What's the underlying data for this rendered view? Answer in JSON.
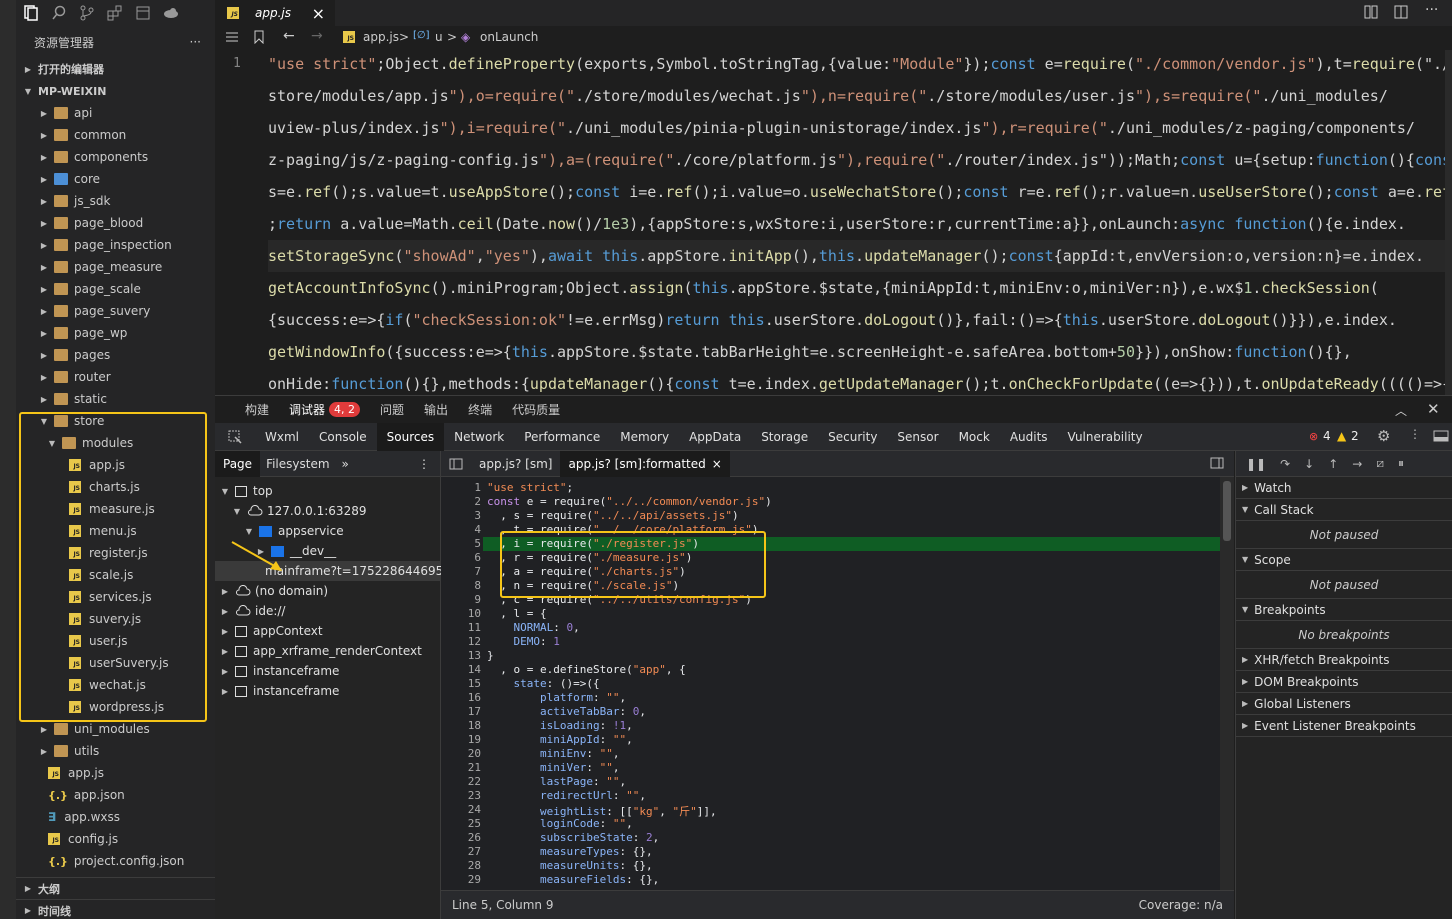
{
  "activity_icons": [
    "files-icon",
    "search-icon",
    "source-control-icon",
    "extensions-icon",
    "layout-icon",
    "cloud-icon"
  ],
  "explorer": {
    "title": "资源管理器",
    "more": "···",
    "open_editors": "打开的编辑器",
    "project": "MP-WEIXIN",
    "folders": [
      {
        "label": "api"
      },
      {
        "label": "common"
      },
      {
        "label": "components"
      },
      {
        "label": "core",
        "blue": true
      },
      {
        "label": "js_sdk"
      },
      {
        "label": "page_blood"
      },
      {
        "label": "page_inspection"
      },
      {
        "label": "page_measure"
      },
      {
        "label": "page_scale"
      },
      {
        "label": "page_suvery"
      },
      {
        "label": "page_wp"
      },
      {
        "label": "pages"
      },
      {
        "label": "router"
      },
      {
        "label": "static"
      }
    ],
    "store": {
      "label": "store",
      "modules": {
        "label": "modules",
        "files": [
          "app.js",
          "charts.js",
          "measure.js",
          "menu.js",
          "register.js",
          "scale.js",
          "services.js",
          "suvery.js",
          "user.js",
          "userSuvery.js",
          "wechat.js",
          "wordpress.js"
        ]
      }
    },
    "after_folders": [
      {
        "label": "uni_modules"
      },
      {
        "label": "utils"
      }
    ],
    "root_files": [
      {
        "label": "app.js",
        "type": "js"
      },
      {
        "label": "app.json",
        "type": "json"
      },
      {
        "label": "app.wxss",
        "type": "css"
      },
      {
        "label": "config.js",
        "type": "js"
      },
      {
        "label": "project.config.json",
        "type": "json"
      }
    ],
    "outline": "大纲",
    "timeline": "时间线"
  },
  "editor": {
    "tab": "app.js",
    "close": "×",
    "breadcrumb": {
      "file": "app.js",
      "sep": ">",
      "symbol1": "u",
      "symbol2": "onLaunch"
    },
    "line_number": "1"
  },
  "panel": {
    "tabs": [
      "构建",
      "调试器",
      "问题",
      "输出",
      "终端",
      "代码质量"
    ],
    "active_tab": "调试器",
    "badge": "4, 2"
  },
  "devtools": {
    "tabs": [
      "Wxml",
      "Console",
      "Sources",
      "Network",
      "Performance",
      "Memory",
      "AppData",
      "Storage",
      "Security",
      "Sensor",
      "Mock",
      "Audits",
      "Vulnerability"
    ],
    "active": "Sources",
    "errors": "4",
    "warnings": "2"
  },
  "navigator": {
    "tabs": [
      "Page",
      "Filesystem"
    ],
    "more": "»",
    "tree": [
      {
        "label": "top",
        "depth": 0,
        "open": true,
        "icon": "frame"
      },
      {
        "label": "127.0.0.1:63289",
        "depth": 1,
        "open": true,
        "icon": "cloud"
      },
      {
        "label": "appservice",
        "depth": 2,
        "open": true,
        "icon": "folder"
      },
      {
        "label": "__dev__",
        "depth": 3,
        "open": false,
        "icon": "folder"
      },
      {
        "label": "mainframe?t=175228644695",
        "depth": 3,
        "open": null,
        "icon": "file",
        "selected": true
      },
      {
        "label": "(no domain)",
        "depth": 0,
        "open": false,
        "icon": "cloud"
      },
      {
        "label": "ide://",
        "depth": 0,
        "open": false,
        "icon": "cloud"
      },
      {
        "label": "appContext",
        "depth": 0,
        "open": false,
        "icon": "frame"
      },
      {
        "label": "app_xrframe_renderContext",
        "depth": 0,
        "open": false,
        "icon": "frame"
      },
      {
        "label": "instanceframe",
        "depth": 0,
        "open": false,
        "icon": "frame"
      },
      {
        "label": "instanceframe",
        "depth": 0,
        "open": false,
        "icon": "frame"
      }
    ]
  },
  "sources": {
    "tabs": [
      {
        "label": "app.js? [sm]",
        "active": false
      },
      {
        "label": "app.js? [sm]:formatted",
        "active": true
      }
    ],
    "close": "×",
    "status_left": "Line 5, Column 9",
    "status_right": "Coverage: n/a",
    "lines": [
      "\"use strict\";",
      "const e = require(\"../../common/vendor.js\")",
      "  , s = require(\"../../api/assets.js\")",
      "  , t = require(\"../../core/platform.js\")",
      "  , i = require(\"./register.js\")",
      "  , r = require(\"./measure.js\")",
      "  , a = require(\"./charts.js\")",
      "  , n = require(\"./scale.js\")",
      "  , c = require(\"../../utils/config.js\")",
      "  , l = {",
      "    NORMAL: 0,",
      "    DEMO: 1",
      "}",
      "  , o = e.defineStore(\"app\", {",
      "    state: ()=>({",
      "        platform: \"\",",
      "        activeTabBar: 0,",
      "        isLoading: !1,",
      "        miniAppId: \"\",",
      "        miniEnv: \"\",",
      "        miniVer: \"\",",
      "        lastPage: \"\",",
      "        redirectUrl: \"\",",
      "        weightList: [[\"kg\", \"斤\"]],",
      "        loginCode: \"\",",
      "        subscribeState: 2,",
      "        measureTypes: {},",
      "        measureUnits: {},",
      "        measureFields: {},"
    ],
    "highlight_line": 5
  },
  "debugger": {
    "sections": [
      {
        "label": "Watch",
        "open": false
      },
      {
        "label": "Call Stack",
        "open": true,
        "body": "Not paused"
      },
      {
        "label": "Scope",
        "open": true,
        "body": "Not paused"
      },
      {
        "label": "Breakpoints",
        "open": true,
        "body": "No breakpoints"
      },
      {
        "label": "XHR/fetch Breakpoints",
        "open": false
      },
      {
        "label": "DOM Breakpoints",
        "open": false
      },
      {
        "label": "Global Listeners",
        "open": false
      },
      {
        "label": "Event Listener Breakpoints",
        "open": false
      }
    ]
  },
  "code_lines": [
    "\"use strict\";Object.defineProperty(exports,Symbol.toStringTag,{value:\"Module\"});const e=require(\"./common/vendor.js\"),t=require(\"./",
    "store/modules/app.js\"),o=require(\"./store/modules/wechat.js\"),n=require(\"./store/modules/user.js\"),s=require(\"./uni_modules/",
    "uview-plus/index.js\"),i=require(\"./uni_modules/pinia-plugin-unistorage/index.js\"),r=require(\"./uni_modules/z-paging/components/",
    "z-paging/js/z-paging-config.js\"),a=(require(\"./core/platform.js\"),require(\"./router/index.js\"));Math;const u={setup:function(){const",
    "s=e.ref();s.value=t.useAppStore();const i=e.ref();i.value=o.useWechatStore();const r=e.ref();r.value=n.useUserStore();const a=e.ref()",
    ";return a.value=Math.ceil(Date.now()/1e3),{appStore:s,wxStore:i,userStore:r,currentTime:a}},onLaunch:async function(){e.index.",
    "setStorageSync(\"showAd\",\"yes\"),await this.appStore.initApp(),this.updateManager();const{appId:t,envVersion:o,version:n}=e.index.",
    "getAccountInfoSync().miniProgram;Object.assign(this.appStore.$state,{miniAppId:t,miniEnv:o,miniVer:n}),e.wx$1.checkSession(",
    "{success:e=>{if(\"checkSession:ok\"!=e.errMsg)return this.userStore.doLogout()},fail:()=>{this.userStore.doLogout()}}),e.index.",
    "getWindowInfo({success:e=>{this.appStore.$state.tabBarHeight=e.screenHeight-e.safeArea.bottom+50}}),onShow:function(){},",
    "onHide:function(){},methods:{updateManager(){const t=e.index.getUpdateManager();t.onCheckForUpdate((e=>{})),t.onUpdateReady(((()=>{e."
  ]
}
